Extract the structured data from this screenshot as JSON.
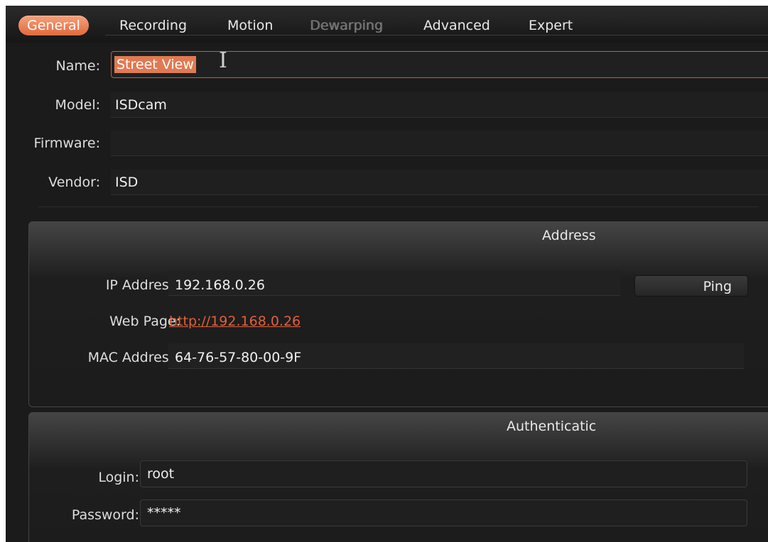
{
  "tabs": [
    {
      "label": "General"
    },
    {
      "label": "Recording"
    },
    {
      "label": "Motion"
    },
    {
      "label": "Dewarping"
    },
    {
      "label": "Advanced"
    },
    {
      "label": "Expert"
    }
  ],
  "general": {
    "name_label": "Name:",
    "name_value": "Street View",
    "model_label": "Model:",
    "model_value": "ISDcam",
    "firmware_label": "Firmware:",
    "firmware_value": "",
    "vendor_label": "Vendor:",
    "vendor_value": "ISD"
  },
  "address": {
    "title": "Address",
    "ip_label": "IP Address:",
    "ip_value": "192.168.0.26",
    "ping_label": "Ping",
    "web_label": "Web Page:",
    "web_value": "http://192.168.0.26",
    "mac_label": "MAC Address:",
    "mac_value": "64-76-57-80-00-9F"
  },
  "auth": {
    "title": "Authenticatic",
    "login_label": "Login:",
    "login_value": "root",
    "password_label": "Password:",
    "password_value": "*****"
  },
  "colors": {
    "accent": "#e06a3f",
    "background": "#1b1b1b",
    "link": "#e0603a"
  }
}
